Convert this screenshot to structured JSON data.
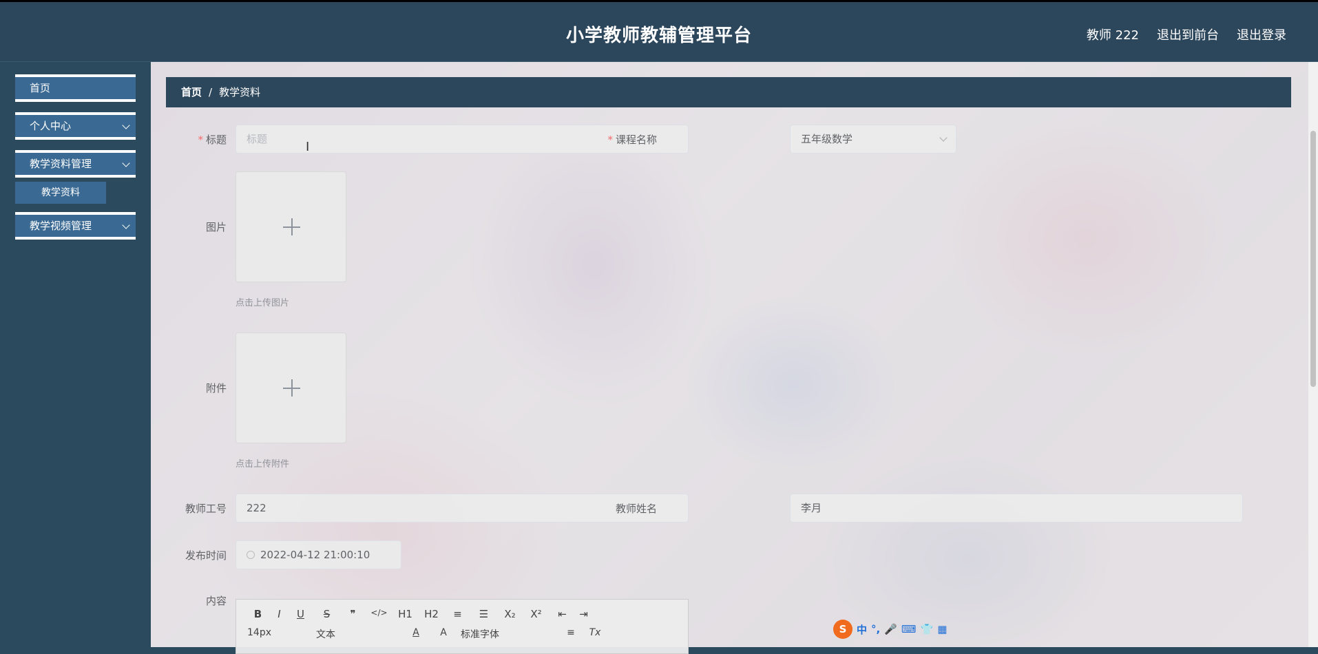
{
  "header": {
    "title": "小学教师教辅管理平台",
    "user": "教师 222",
    "to_front": "退出到前台",
    "logout": "退出登录"
  },
  "sidebar": {
    "items": [
      {
        "label": "首页"
      },
      {
        "label": "个人中心"
      },
      {
        "label": "教学资料管理"
      },
      {
        "label": "教学视频管理"
      }
    ],
    "sub_item": "教学资料"
  },
  "breadcrumb": {
    "home": "首页",
    "sep": "/",
    "current": "教学资料"
  },
  "form": {
    "title_label": "标题",
    "title_placeholder": "标题",
    "course_label": "课程名称",
    "course_value": "五年级数学",
    "image_label": "图片",
    "image_tip": "点击上传图片",
    "attachment_label": "附件",
    "attachment_tip": "点击上传附件",
    "teacher_id_label": "教师工号",
    "teacher_id_value": "222",
    "teacher_name_label": "教师姓名",
    "teacher_name_value": "李月",
    "publish_time_label": "发布时间",
    "publish_time_value": "2022-04-12 21:00:10",
    "content_label": "内容"
  },
  "editor": {
    "row1": [
      "B",
      "I",
      "U",
      "S",
      "❞",
      "</>",
      "H1",
      "H2",
      "≡",
      "☰",
      "X₂",
      "X²",
      "⇤",
      "⇥"
    ],
    "font_size": "14px",
    "block": "文本",
    "font": "标准字体",
    "clear": "Tx"
  },
  "ime": {
    "logo": "S",
    "lang": "中",
    "icons": [
      "°,",
      "🎤",
      "⌨",
      "👕",
      "▦"
    ]
  }
}
